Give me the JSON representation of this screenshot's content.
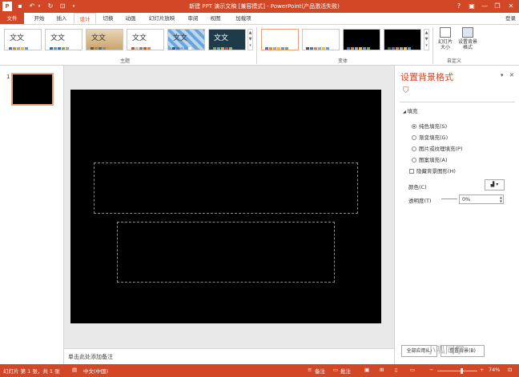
{
  "app": {
    "title": "新建 PPT 演示文稿 [兼容模式] - PowerPoint(产品激活失败)",
    "login": "登录"
  },
  "quick_access": {
    "save_icon": "save-icon",
    "undo_icon": "undo-icon",
    "redo_icon": "redo-icon",
    "start_icon": "present-icon"
  },
  "tabs": [
    "文件",
    "开始",
    "插入",
    "设计",
    "切换",
    "动画",
    "幻灯片放映",
    "审阅",
    "视图",
    "加载项"
  ],
  "ribbon": {
    "themes_label": "主题",
    "variants_label": "变体",
    "customize_label": "自定义",
    "theme_text": "文文",
    "slide_size_label": "幻灯片大小",
    "format_bg_label": "设置背景格式"
  },
  "thumbnails": {
    "number": "1"
  },
  "notes": {
    "placeholder": "单击此处添加备注"
  },
  "format_pane": {
    "title": "设置背景格式",
    "section": "填充",
    "options": [
      "纯色填充(S)",
      "渐变填充(G)",
      "图片或纹理填充(P)",
      "图案填充(A)"
    ],
    "selected": "纯色填充(S)",
    "hide_graphics": "隐藏背景图形(H)",
    "color_label": "颜色(C)",
    "transparency_label": "透明度(T)",
    "transparency_value": "0%",
    "apply_all": "全部应用(L)",
    "reset": "重置背景(B)"
  },
  "status": {
    "slide_info": "幻灯片 第 1 张，共 1 张",
    "language": "中文(中国)",
    "notes": "备注",
    "comments": "批注",
    "zoom": "74%"
  },
  "watermark": "小呱同学",
  "colors": {
    "accent": "#d24726",
    "slide_bg": "#000000",
    "stage_bg": "#e9e9e9"
  }
}
